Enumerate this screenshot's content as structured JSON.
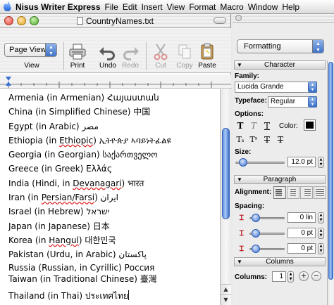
{
  "menubar": {
    "app": "Nisus Writer Express",
    "items": [
      "File",
      "Edit",
      "Insert",
      "View",
      "Format",
      "Macro",
      "Window",
      "Help"
    ]
  },
  "window": {
    "title": "CountryNames.txt"
  },
  "toolbar": {
    "view_popup": "Page View",
    "view_label": "View",
    "print_label": "Print",
    "undo_label": "Undo",
    "redo_label": "Redo",
    "cut_label": "Cut",
    "copy_label": "Copy",
    "paste_label": "Paste"
  },
  "document": {
    "lines": [
      {
        "before": "Armenia (in Armenian) ",
        "spell": "",
        "after": "Հայաստան"
      },
      {
        "before": "China (in Simplified Chinese) 中国",
        "spell": "",
        "after": ""
      },
      {
        "before": "Egypt (in Arabic) مصر",
        "spell": "",
        "after": ""
      },
      {
        "before": "Ethiopia (in ",
        "spell": "Ethiopic",
        "after": ") ኢትዮጵያ ኣባይነትፊልዩ"
      },
      {
        "before": "Georgia (in Georgian) საქართველო",
        "spell": "",
        "after": ""
      },
      {
        "before": "Greece (in Greek) Ελλάς",
        "spell": "",
        "after": ""
      },
      {
        "before": "India (Hindi, in ",
        "spell": "Devanagari",
        "after": ") भारत"
      },
      {
        "before": "Iran (in ",
        "spell": "Persian/Farsi",
        "after": ") ایران"
      },
      {
        "before": "Israel (in Hebrew) ישראל",
        "spell": "",
        "after": ""
      },
      {
        "before": "Japan (in Japanese) 日本",
        "spell": "",
        "after": ""
      },
      {
        "before": "Korea (in ",
        "spell": "Hangul",
        "after": ") 대한민국"
      },
      {
        "before": "Pakistan (Urdu, in Arabic) پاکستان",
        "spell": "",
        "after": ""
      },
      {
        "before": "Russia (Russian, in Cyrillic) Россия",
        "spell": "",
        "after": ""
      },
      {
        "before": "Taiwan (in Traditional Chinese) 臺灣",
        "spell": "",
        "after": ""
      },
      {
        "before": "Thailand (in Thai) ประเทศไทย",
        "spell": "",
        "after": ""
      }
    ]
  },
  "palette": {
    "formatting_popup": "Formatting",
    "character": {
      "header": "Character",
      "family_label": "Family:",
      "family_value": "Lucida Grande",
      "typeface_label": "Typeface:",
      "typeface_value": "Regular",
      "options_label": "Options:",
      "color_label": "Color:",
      "color_value": "#000000",
      "size_label": "Size:",
      "size_value": "12.0 pt"
    },
    "paragraph": {
      "header": "Paragraph",
      "alignment_label": "Alignment:",
      "spacing_label": "Spacing:",
      "spacing_values": [
        "0 lin",
        "0 pt",
        "0 pt"
      ]
    },
    "columns": {
      "header": "Columns",
      "columns_label": "Columns:",
      "columns_value": "1"
    }
  }
}
